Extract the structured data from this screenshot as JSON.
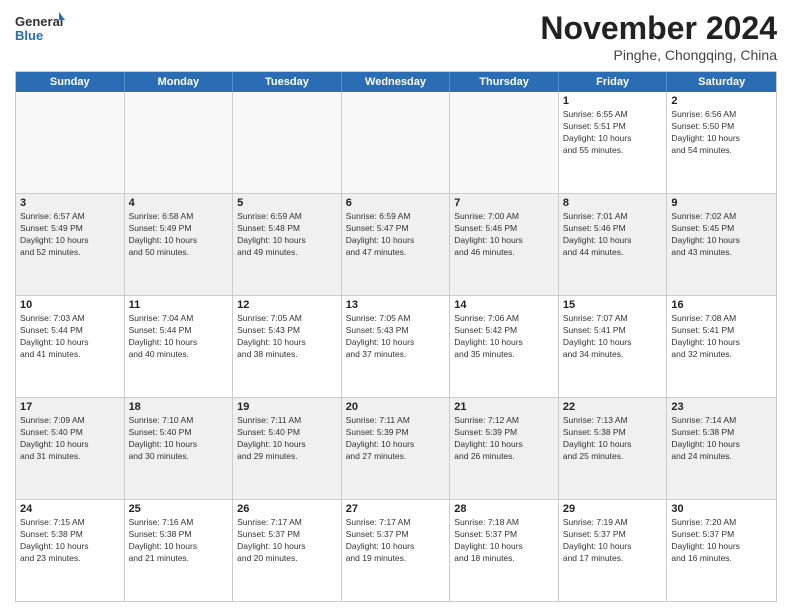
{
  "logo": {
    "general": "General",
    "blue": "Blue"
  },
  "title": "November 2024",
  "location": "Pinghe, Chongqing, China",
  "days_header": [
    "Sunday",
    "Monday",
    "Tuesday",
    "Wednesday",
    "Thursday",
    "Friday",
    "Saturday"
  ],
  "weeks": [
    [
      {
        "day": "",
        "info": ""
      },
      {
        "day": "",
        "info": ""
      },
      {
        "day": "",
        "info": ""
      },
      {
        "day": "",
        "info": ""
      },
      {
        "day": "",
        "info": ""
      },
      {
        "day": "1",
        "info": "Sunrise: 6:55 AM\nSunset: 5:51 PM\nDaylight: 10 hours\nand 55 minutes."
      },
      {
        "day": "2",
        "info": "Sunrise: 6:56 AM\nSunset: 5:50 PM\nDaylight: 10 hours\nand 54 minutes."
      }
    ],
    [
      {
        "day": "3",
        "info": "Sunrise: 6:57 AM\nSunset: 5:49 PM\nDaylight: 10 hours\nand 52 minutes."
      },
      {
        "day": "4",
        "info": "Sunrise: 6:58 AM\nSunset: 5:49 PM\nDaylight: 10 hours\nand 50 minutes."
      },
      {
        "day": "5",
        "info": "Sunrise: 6:59 AM\nSunset: 5:48 PM\nDaylight: 10 hours\nand 49 minutes."
      },
      {
        "day": "6",
        "info": "Sunrise: 6:59 AM\nSunset: 5:47 PM\nDaylight: 10 hours\nand 47 minutes."
      },
      {
        "day": "7",
        "info": "Sunrise: 7:00 AM\nSunset: 5:46 PM\nDaylight: 10 hours\nand 46 minutes."
      },
      {
        "day": "8",
        "info": "Sunrise: 7:01 AM\nSunset: 5:46 PM\nDaylight: 10 hours\nand 44 minutes."
      },
      {
        "day": "9",
        "info": "Sunrise: 7:02 AM\nSunset: 5:45 PM\nDaylight: 10 hours\nand 43 minutes."
      }
    ],
    [
      {
        "day": "10",
        "info": "Sunrise: 7:03 AM\nSunset: 5:44 PM\nDaylight: 10 hours\nand 41 minutes."
      },
      {
        "day": "11",
        "info": "Sunrise: 7:04 AM\nSunset: 5:44 PM\nDaylight: 10 hours\nand 40 minutes."
      },
      {
        "day": "12",
        "info": "Sunrise: 7:05 AM\nSunset: 5:43 PM\nDaylight: 10 hours\nand 38 minutes."
      },
      {
        "day": "13",
        "info": "Sunrise: 7:05 AM\nSunset: 5:43 PM\nDaylight: 10 hours\nand 37 minutes."
      },
      {
        "day": "14",
        "info": "Sunrise: 7:06 AM\nSunset: 5:42 PM\nDaylight: 10 hours\nand 35 minutes."
      },
      {
        "day": "15",
        "info": "Sunrise: 7:07 AM\nSunset: 5:41 PM\nDaylight: 10 hours\nand 34 minutes."
      },
      {
        "day": "16",
        "info": "Sunrise: 7:08 AM\nSunset: 5:41 PM\nDaylight: 10 hours\nand 32 minutes."
      }
    ],
    [
      {
        "day": "17",
        "info": "Sunrise: 7:09 AM\nSunset: 5:40 PM\nDaylight: 10 hours\nand 31 minutes."
      },
      {
        "day": "18",
        "info": "Sunrise: 7:10 AM\nSunset: 5:40 PM\nDaylight: 10 hours\nand 30 minutes."
      },
      {
        "day": "19",
        "info": "Sunrise: 7:11 AM\nSunset: 5:40 PM\nDaylight: 10 hours\nand 29 minutes."
      },
      {
        "day": "20",
        "info": "Sunrise: 7:11 AM\nSunset: 5:39 PM\nDaylight: 10 hours\nand 27 minutes."
      },
      {
        "day": "21",
        "info": "Sunrise: 7:12 AM\nSunset: 5:39 PM\nDaylight: 10 hours\nand 26 minutes."
      },
      {
        "day": "22",
        "info": "Sunrise: 7:13 AM\nSunset: 5:38 PM\nDaylight: 10 hours\nand 25 minutes."
      },
      {
        "day": "23",
        "info": "Sunrise: 7:14 AM\nSunset: 5:38 PM\nDaylight: 10 hours\nand 24 minutes."
      }
    ],
    [
      {
        "day": "24",
        "info": "Sunrise: 7:15 AM\nSunset: 5:38 PM\nDaylight: 10 hours\nand 23 minutes."
      },
      {
        "day": "25",
        "info": "Sunrise: 7:16 AM\nSunset: 5:38 PM\nDaylight: 10 hours\nand 21 minutes."
      },
      {
        "day": "26",
        "info": "Sunrise: 7:17 AM\nSunset: 5:37 PM\nDaylight: 10 hours\nand 20 minutes."
      },
      {
        "day": "27",
        "info": "Sunrise: 7:17 AM\nSunset: 5:37 PM\nDaylight: 10 hours\nand 19 minutes."
      },
      {
        "day": "28",
        "info": "Sunrise: 7:18 AM\nSunset: 5:37 PM\nDaylight: 10 hours\nand 18 minutes."
      },
      {
        "day": "29",
        "info": "Sunrise: 7:19 AM\nSunset: 5:37 PM\nDaylight: 10 hours\nand 17 minutes."
      },
      {
        "day": "30",
        "info": "Sunrise: 7:20 AM\nSunset: 5:37 PM\nDaylight: 10 hours\nand 16 minutes."
      }
    ]
  ]
}
